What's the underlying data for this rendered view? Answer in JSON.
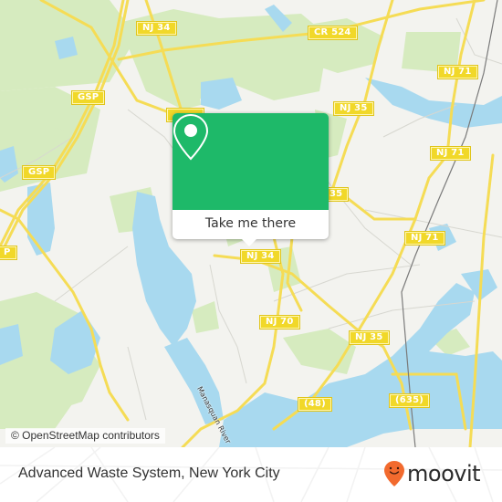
{
  "map": {
    "attribution": "© OpenStreetMap contributors",
    "river_label": "Manasquan River",
    "colors": {
      "land": "#f3f3ef",
      "park": "#cfe6b5",
      "water": "#a8d9ef",
      "road": "#f5dc55",
      "shield": "#f1d829"
    },
    "route_shields": [
      {
        "id": "nj34-north",
        "label": "NJ 34"
      },
      {
        "id": "cr524",
        "label": "CR 524"
      },
      {
        "id": "gsp-north",
        "label": "GSP"
      },
      {
        "id": "gsp-mid",
        "label": "GSP"
      },
      {
        "id": "gsp-west",
        "label": "P"
      },
      {
        "id": "nj35-north",
        "label": "NJ 35"
      },
      {
        "id": "nj35-mid",
        "label": "35"
      },
      {
        "id": "nj71-north",
        "label": "NJ 71"
      },
      {
        "id": "nj71-mid",
        "label": "NJ 71"
      },
      {
        "id": "nj71-south",
        "label": "NJ 71"
      },
      {
        "id": "nj34-south",
        "label": "NJ 34"
      },
      {
        "id": "nj70",
        "label": "NJ 70"
      },
      {
        "id": "nj35-south",
        "label": "NJ 35"
      },
      {
        "id": "cr48",
        "label": "(48)"
      },
      {
        "id": "cr635",
        "label": "(635)"
      },
      {
        "id": "nj34-top",
        "label": ""
      }
    ]
  },
  "popup": {
    "icon": "map-pin-icon",
    "action_label": "Take me there",
    "accent": "#1eb969"
  },
  "footer": {
    "place_name": "Advanced Waste System, New York City",
    "brand": {
      "name": "moovit",
      "icon": "moovit-pin-icon",
      "color": "#f26a2e"
    }
  }
}
